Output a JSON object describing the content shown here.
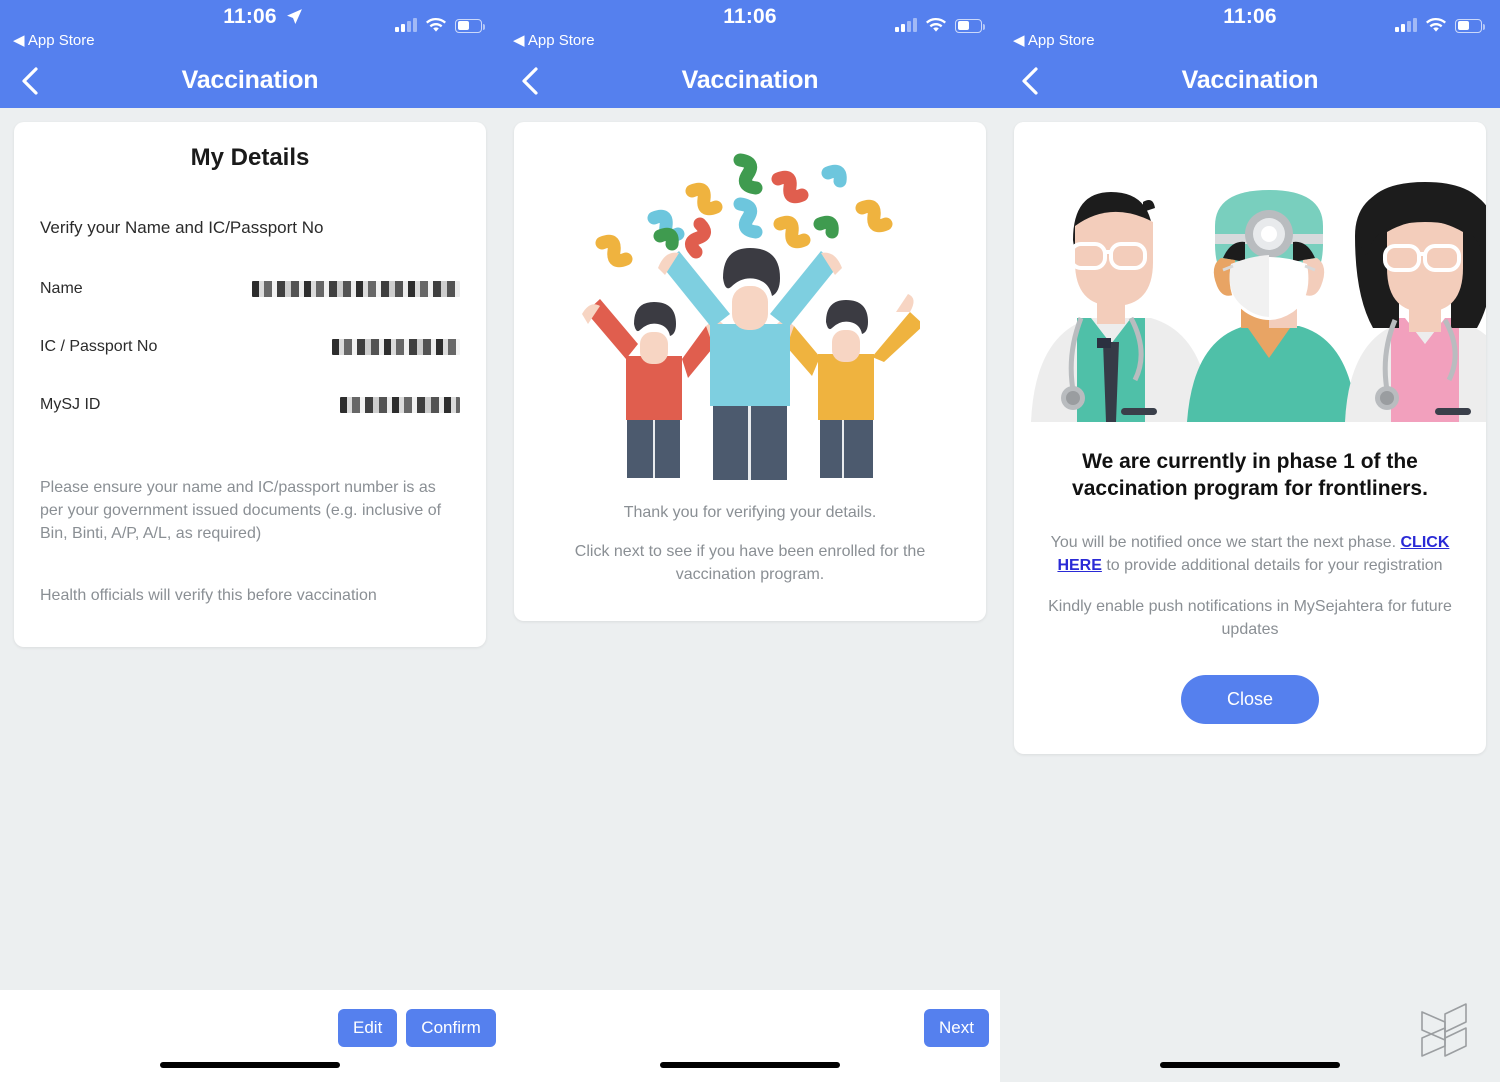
{
  "colors": {
    "brand_blue": "#5580ee",
    "page_background": "#eceff0",
    "card_white": "#ffffff",
    "muted_text": "#8a8f94",
    "link_blue": "#2a2ad6"
  },
  "status_bar": {
    "time": "11:06",
    "back_label": "◀ App Store",
    "signal_icon": "cellular-signal-icon",
    "wifi_icon": "wifi-icon",
    "battery_icon": "battery-icon",
    "location_icon": "location-arrow-icon"
  },
  "nav_bar": {
    "title": "Vaccination",
    "back_icon": "chevron-left-icon"
  },
  "panel_1": {
    "card_title": "My Details",
    "verify_instruction": "Verify your Name and IC/Passport No",
    "fields": [
      {
        "label": "Name",
        "value": "██████████████",
        "redacted": true
      },
      {
        "label": "IC / Passport No",
        "value": "████████",
        "redacted": true
      },
      {
        "label": "MySJ ID",
        "value": "███████",
        "redacted": true
      }
    ],
    "note_1": "Please ensure your name and IC/passport number is as per your government issued documents (e.g. inclusive of Bin, Binti, A/P, A/L, as required)",
    "note_2": "Health officials will verify this before vaccination"
  },
  "panel_2": {
    "illustration": "celebrating-people-confetti-illustration",
    "thanks_line_1": "Thank you for verifying your details.",
    "thanks_line_2": "Click next to see if you have been enrolled for the vaccination program."
  },
  "panel_3": {
    "illustration": "medical-team-doctors-illustration",
    "phase_title": "We are currently in phase 1 of the vaccination program for frontliners.",
    "body_before_link": "You will be notified once we start the next phase. ",
    "link_text": "CLICK HERE",
    "body_after_link": " to provide additional details for your registration",
    "body_2": "Kindly enable push notifications in MySejahtera for future updates",
    "close_label": "Close"
  },
  "bottom_bar": {
    "edit_label": "Edit",
    "confirm_label": "Confirm",
    "next_label": "Next"
  },
  "watermark": {
    "icon": "wireframe-s-logo-icon"
  }
}
